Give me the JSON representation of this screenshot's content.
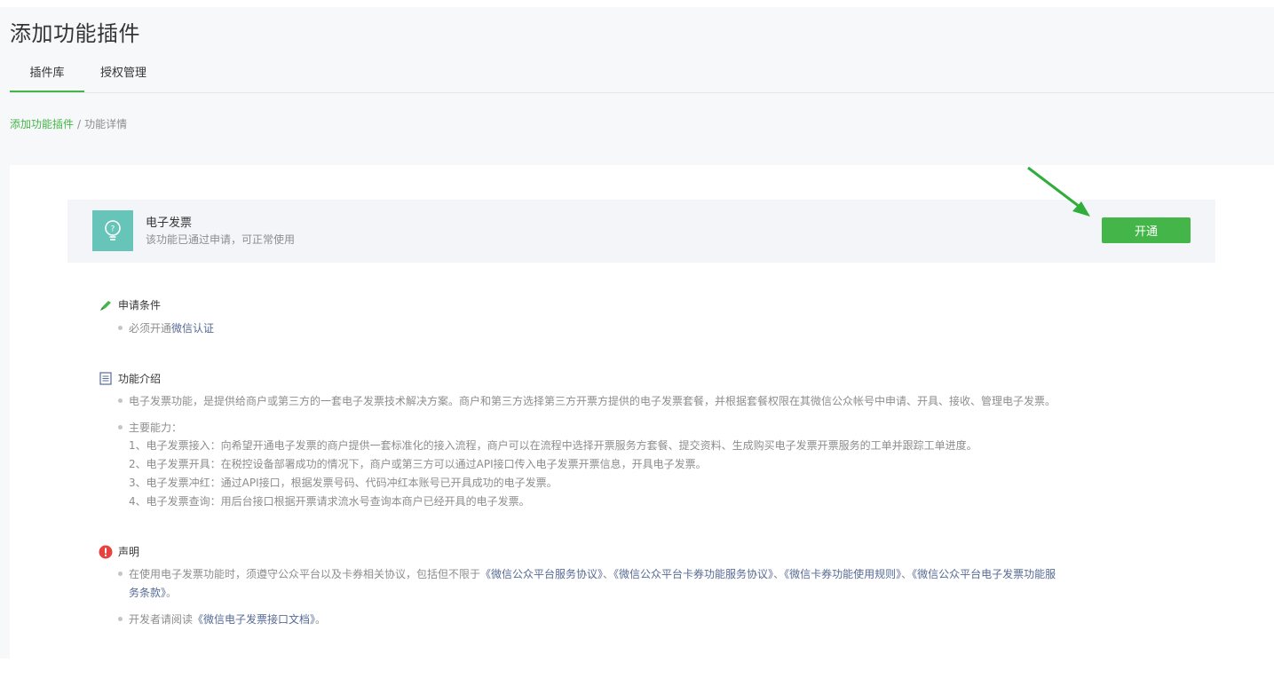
{
  "page": {
    "title": "添加功能插件"
  },
  "tabs": [
    {
      "label": "插件库",
      "active": true
    },
    {
      "label": "授权管理",
      "active": false
    }
  ],
  "breadcrumb": {
    "parent": "添加功能插件",
    "separator": "/",
    "current": "功能详情"
  },
  "plugin": {
    "icon": "lightbulb-icon",
    "name": "电子发票",
    "status": "该功能已通过申请，可正常使用",
    "open_label": "开通"
  },
  "conditions": {
    "title": "申请条件",
    "icon": "pen-icon",
    "text_prefix": "必须开通",
    "text_link": "微信认证"
  },
  "intro": {
    "title": "功能介绍",
    "icon": "document-icon",
    "description": "电子发票功能，是提供给商户或第三方的一套电子发票技术解决方案。商户和第三方选择第三方开票方提供的电子发票套餐，并根据套餐权限在其微信公众帐号中申请、开具、接收、管理电子发票。",
    "capabilities_title": "主要能力：",
    "capabilities": [
      "1、电子发票接入：向希望开通电子发票的商户提供一套标准化的接入流程，商户可以在流程中选择开票服务方套餐、提交资料、生成购买电子发票开票服务的工单并跟踪工单进度。",
      "2、电子发票开具：在税控设备部署成功的情况下，商户或第三方可以通过API接口传入电子发票开票信息，开具电子发票。",
      "3、电子发票冲红：通过API接口，根据发票号码、代码冲红本账号已开具成功的电子发票。",
      "4、电子发票查询：用后台接口根据开票请求流水号查询本商户已经开具的电子发票。"
    ]
  },
  "statement": {
    "title": "声明",
    "icon": "warning-icon",
    "line1_prefix": "在使用电子发票功能时，须遵守公众平台以及卡券相关协议，包括但不限于",
    "line1_link1": "《微信公众平台服务协议》",
    "sep1": "、",
    "line1_link2": "《微信公众平台卡券功能服务协议》",
    "sep2": "、",
    "line1_link3": "《微信卡券功能使用规则》",
    "sep3": "、",
    "line1_link4a": "《微信公众平台电子发票功能服",
    "line1_link4b": "务条款》",
    "line1_end": "。",
    "line2_prefix": "开发者请阅读",
    "line2_link": "《微信电子发票接口文档》",
    "line2_end": "。"
  },
  "colors": {
    "accent": "#44b549",
    "link": "#576b95",
    "icon_bg": "#66c4b8",
    "warning": "#e64340"
  }
}
